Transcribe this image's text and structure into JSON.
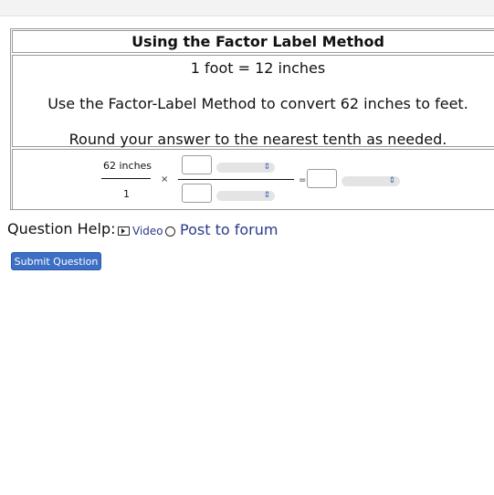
{
  "question": {
    "title": "Using the Factor Label Method",
    "conversion": "1 foot = 12 inches",
    "instruction": "Use the Factor-Label Method to convert 62 inches to feet.",
    "rounding": "Round your answer to the nearest tenth as needed."
  },
  "work": {
    "given_numerator": "62 inches",
    "given_denominator": "1",
    "times_symbol": "×",
    "equals_symbol": "=",
    "numerator_value": "",
    "numerator_unit": "",
    "denominator_value": "",
    "denominator_unit": "",
    "answer_value": "",
    "answer_unit": ""
  },
  "help": {
    "label": "Question Help:",
    "video_label": "Video",
    "forum_label": "Post to forum"
  },
  "submit_label": "Submit Question",
  "colors": {
    "link": "#2a3a8c",
    "button": "#3d6fc4",
    "select_bg": "#e4e4e4",
    "border": "#9a9a9a"
  },
  "icons": [
    "video-icon",
    "forum-icon",
    "chevron-updown-icon"
  ]
}
